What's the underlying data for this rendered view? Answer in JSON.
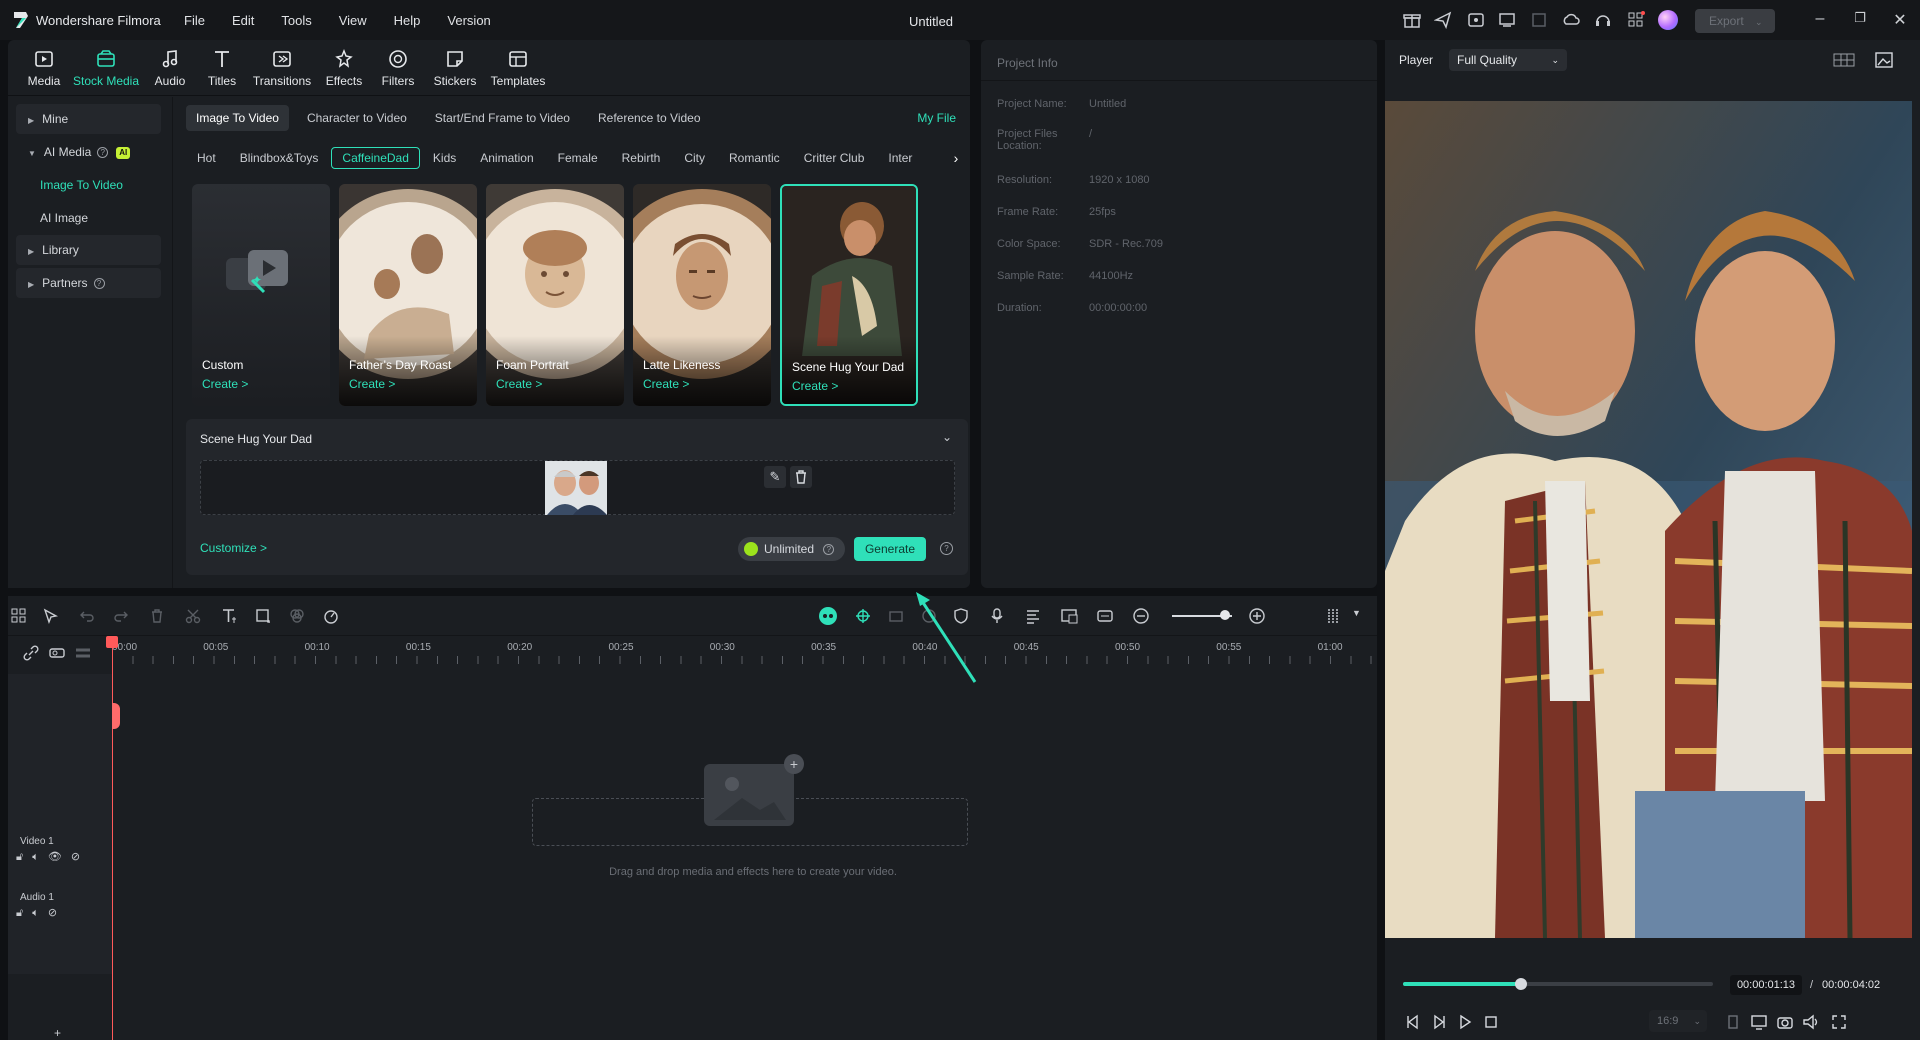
{
  "app": {
    "name": "Wondershare Filmora",
    "doc_title": "Untitled",
    "export_label": "Export"
  },
  "menu": [
    "File",
    "Edit",
    "Tools",
    "View",
    "Help",
    "Version"
  ],
  "toolbar": [
    {
      "label": "Media",
      "icon": "media-icon"
    },
    {
      "label": "Stock Media",
      "icon": "stock-media-icon"
    },
    {
      "label": "Audio",
      "icon": "audio-icon"
    },
    {
      "label": "Titles",
      "icon": "titles-icon"
    },
    {
      "label": "Transitions",
      "icon": "transitions-icon"
    },
    {
      "label": "Effects",
      "icon": "effects-icon"
    },
    {
      "label": "Filters",
      "icon": "filters-icon"
    },
    {
      "label": "Stickers",
      "icon": "stickers-icon"
    },
    {
      "label": "Templates",
      "icon": "templates-icon"
    }
  ],
  "sidebar": {
    "items": [
      {
        "label": "Mine"
      },
      {
        "label": "AI Media",
        "badge": "AI"
      },
      {
        "label": "Image To Video"
      },
      {
        "label": "AI Image"
      },
      {
        "label": "Library"
      },
      {
        "label": "Partners"
      }
    ]
  },
  "subtabs": [
    "Image To Video",
    "Character to Video",
    "Start/End Frame to Video",
    "Reference to Video"
  ],
  "my_file": "My File",
  "categories": [
    "Hot",
    "Blindbox&Toys",
    "CaffeineDad",
    "Kids",
    "Animation",
    "Female",
    "Rebirth",
    "City",
    "Romantic",
    "Critter Club",
    "Inter"
  ],
  "cards": [
    {
      "name": "Custom",
      "action": "Create >"
    },
    {
      "name": "Father's Day Roast",
      "action": "Create >"
    },
    {
      "name": "Foam Portrait",
      "action": "Create >"
    },
    {
      "name": "Latte Likeness",
      "action": "Create >"
    },
    {
      "name": "Scene Hug Your Dad",
      "action": "Create >"
    }
  ],
  "detail": {
    "title": "Scene Hug Your Dad",
    "customize": "Customize >",
    "unlimited": "Unlimited",
    "generate": "Generate"
  },
  "project_info": {
    "header": "Project Info",
    "rows": [
      {
        "k": "Project Name:",
        "v": "Untitled"
      },
      {
        "k": "Project Files Location:",
        "v": "/"
      },
      {
        "k": "Resolution:",
        "v": "1920 x 1080"
      },
      {
        "k": "Frame Rate:",
        "v": "25fps"
      },
      {
        "k": "Color Space:",
        "v": "SDR - Rec.709"
      },
      {
        "k": "Sample Rate:",
        "v": "44100Hz"
      },
      {
        "k": "Duration:",
        "v": "00:00:00:00"
      }
    ]
  },
  "player": {
    "label": "Player",
    "quality": "Full Quality",
    "progress": 0.38,
    "current": "00:00:01:13",
    "separator": "/",
    "total": "00:00:04:02",
    "ratio": "16:9"
  },
  "timeline": {
    "ruler": [
      "00:00",
      "00:05",
      "00:10",
      "00:15",
      "00:20",
      "00:25",
      "00:30",
      "00:35",
      "00:40",
      "00:45",
      "00:50",
      "00:55",
      "01:00"
    ],
    "tracks": [
      "Video 1",
      "Audio 1"
    ],
    "drop_text": "Drag and drop media and effects here to create your video."
  },
  "colors": {
    "accent": "#2fe0b9",
    "badge": "#c6f135",
    "playhead": "#ff5a5a"
  }
}
